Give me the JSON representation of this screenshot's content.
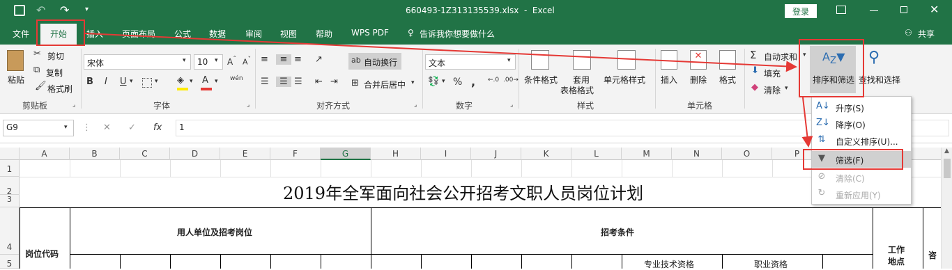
{
  "window": {
    "title": "660493-1Z313135539.xlsx  -  Excel",
    "login": "登录"
  },
  "tabs": [
    "文件",
    "开始",
    "插入",
    "页面布局",
    "公式",
    "数据",
    "审阅",
    "视图",
    "帮助",
    "WPS PDF"
  ],
  "tell_me": "告诉我你想要做什么",
  "share": "共享",
  "clipboard": {
    "paste": "粘贴",
    "cut": "剪切",
    "copy": "复制",
    "format_painter": "格式刷",
    "group": "剪贴板"
  },
  "font": {
    "name": "宋体",
    "size": "10",
    "bold": "B",
    "italic": "I",
    "underline": "U",
    "group": "字体",
    "wen": "wén"
  },
  "alignment": {
    "wrap": "自动换行",
    "merge": "合并后居中",
    "group": "对齐方式"
  },
  "number": {
    "format": "文本",
    "group": "数字",
    "percent": "%",
    "comma": ","
  },
  "styles": {
    "conditional": "条件格式",
    "table_line1": "套用",
    "table_line2": "表格格式",
    "cell_styles": "单元格样式",
    "group": "样式"
  },
  "cells": {
    "insert": "插入",
    "delete": "删除",
    "format": "格式",
    "group": "单元格"
  },
  "editing": {
    "autosum": "自动求和",
    "fill": "填充",
    "clear": "清除",
    "sort_filter": "排序和筛选",
    "find_select": "查找和选择"
  },
  "sort_menu": [
    {
      "icon": "sort-asc-icon",
      "label": "升序(S)",
      "enabled": true
    },
    {
      "icon": "sort-desc-icon",
      "label": "降序(O)",
      "enabled": true
    },
    {
      "icon": "custom-sort-icon",
      "label": "自定义排序(U)...",
      "enabled": true
    },
    {
      "icon": "filter-icon",
      "label": "筛选(F)",
      "enabled": true
    },
    {
      "icon": "clear-filter-icon",
      "label": "清除(C)",
      "enabled": false
    },
    {
      "icon": "reapply-icon",
      "label": "重新应用(Y)",
      "enabled": false
    }
  ],
  "formula_bar": {
    "name_box": "G9",
    "fx": "fx",
    "value": "1"
  },
  "columns": [
    "A",
    "B",
    "C",
    "D",
    "E",
    "F",
    "G",
    "H",
    "I",
    "J",
    "K",
    "L",
    "M",
    "N",
    "O",
    "P"
  ],
  "rows": [
    "1",
    "2",
    "3",
    "4",
    "5"
  ],
  "sheet": {
    "title": "2019年全军面向社会公开招考文职人员岗位计划",
    "h_post_code": "岗位代码",
    "h_employer": "用人单位及招考岗位",
    "h_conditions": "招考条件",
    "h_work_line1": "工作",
    "h_work_line2": "地点",
    "h_consult": "咨",
    "h_pro_tech": "专业技术资格",
    "h_vocational": "职业资格"
  },
  "colors": {
    "excel_green": "#217346",
    "highlight_red": "#e53935",
    "selected_tab_bg": "#f3f3f3"
  }
}
